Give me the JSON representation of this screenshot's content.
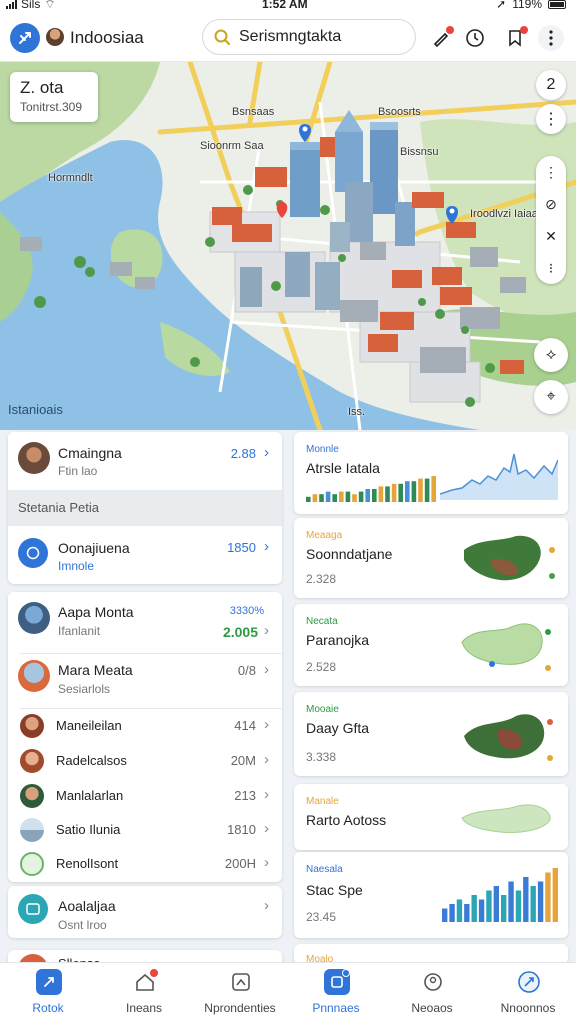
{
  "status_bar": {
    "carrier": "Sils",
    "time": "1:52 AM",
    "battery": "119%"
  },
  "header": {
    "title": "Indoosiaa",
    "search": {
      "value": "Serismngtakta",
      "placeholder": "Serismngtakta"
    },
    "colors": {
      "accent": "#2f74d9",
      "badge": "#e8453c"
    }
  },
  "map": {
    "card": {
      "title": "Z. ota",
      "subtitle": "Tonitrst.309"
    },
    "labels": [
      "Bsnsaas",
      "Bsoosrts",
      "Sioonrm Saa",
      "Bissnsu",
      "Hormndlt",
      "Iroodlvzi Iaiaa",
      "Iss."
    ],
    "bottom_label": "Istanioais",
    "controls": [
      "2",
      "⋮",
      "⋮",
      "⊘",
      "✕",
      "⁝",
      "⟡",
      "⌖"
    ]
  },
  "left_panel": {
    "top_row": {
      "title": "Cmaingna",
      "subtitle": "Ftin lao",
      "value": "2.88"
    },
    "section_header": "Stetania Petia",
    "highlight_row": {
      "title": "Oonajiuena",
      "subtitle": "Imnole",
      "value": "1850"
    },
    "list_rows": [
      {
        "title": "Aapa Monta",
        "subtitle": "Ifanlanit",
        "value": "3330%",
        "value2": "2.005"
      },
      {
        "title": "Mara Meata",
        "subtitle": "Sesiarlols",
        "value": "0/8"
      },
      {
        "title": "Maneileilan",
        "value": "414"
      },
      {
        "title": "Radelcalsos",
        "value": "20M"
      },
      {
        "title": "Manlalarlan",
        "value": "213"
      },
      {
        "title": "Satio Ilunia",
        "value": "1810"
      },
      {
        "title": "RenolIsont",
        "value": "200H"
      }
    ],
    "bottom_row": {
      "title": "Aoalaljaa",
      "subtitle": "Osnt lroo"
    },
    "bottom_partial": {
      "title": "Sllensa"
    }
  },
  "right_cards": [
    {
      "tag": "Monnle",
      "title": "Atrsle Iatala",
      "stat": ""
    },
    {
      "tag": "Meaaga",
      "title": "Soonndatjane",
      "stat": "2.328"
    },
    {
      "tag": "Necata",
      "title": "Paranojka",
      "stat": "2.528"
    },
    {
      "tag": "Mooaie",
      "title": "Daay Gfta",
      "stat": "3.338"
    },
    {
      "tag": "Manale",
      "title": "Rarto Aotoss",
      "stat": ""
    },
    {
      "tag": "Naesala",
      "title": "Stac Spe",
      "stat": "23.45"
    },
    {
      "tag": "Moalo"
    }
  ],
  "chart_data": [
    {
      "type": "bar",
      "title": "Atrsle Iatala",
      "values": [
        2,
        3,
        3,
        4,
        3,
        4,
        4,
        3,
        4,
        5,
        5,
        6,
        6,
        7,
        7,
        8,
        8,
        9,
        9,
        10
      ],
      "colors": [
        "#2e8b57",
        "#e6a53a",
        "#2e8b57",
        "#4a90d9",
        "#2e8b57",
        "#e6a53a"
      ]
    },
    {
      "type": "bar",
      "title": "Stac Spe",
      "values": [
        3,
        4,
        5,
        4,
        6,
        5,
        7,
        8,
        6,
        9,
        7,
        10,
        8,
        9,
        11,
        12
      ]
    }
  ],
  "bottom_nav": [
    {
      "label": "Rotok",
      "icon": "compass-icon",
      "active": true
    },
    {
      "label": "Ineans",
      "icon": "home-icon",
      "active": false
    },
    {
      "label": "Nprondenties",
      "icon": "frame-icon",
      "active": false
    },
    {
      "label": "Pnnnaes",
      "icon": "layers-icon",
      "active": false
    },
    {
      "label": "Neoaos",
      "icon": "person-icon",
      "active": false
    },
    {
      "label": "Nnoonnos",
      "icon": "compass-circle-icon",
      "active": false
    }
  ]
}
